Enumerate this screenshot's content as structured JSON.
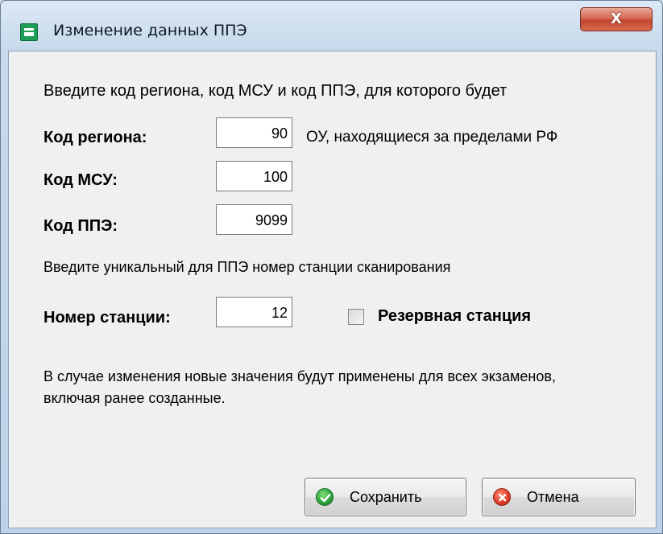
{
  "window": {
    "title": "Изменение данных ППЭ",
    "close_label": "X",
    "icon": "app-icon"
  },
  "instructions": {
    "line1": "Введите код региона, код МСУ и код ППЭ, для которого будет",
    "line2": "Введите уникальный для ППЭ номер станции сканирования",
    "line3": "В случае изменения новые значения будут применены для всех экзаменов, включая ранее созданные."
  },
  "fields": {
    "region": {
      "label": "Код региона:",
      "value": "90"
    },
    "msu": {
      "label": "Код МСУ:",
      "value": "100"
    },
    "ppe": {
      "label": "Код ППЭ:",
      "value": "9099"
    },
    "station": {
      "label": "Номер станции:",
      "value": "12"
    }
  },
  "region_note": "ОУ, находящиеся за пределами РФ",
  "reserve": {
    "label": "Резервная станция",
    "checked": false
  },
  "buttons": {
    "save": {
      "label": "Сохранить",
      "icon": "check-circle-icon"
    },
    "cancel": {
      "label": "Отмена",
      "icon": "x-circle-icon"
    }
  }
}
